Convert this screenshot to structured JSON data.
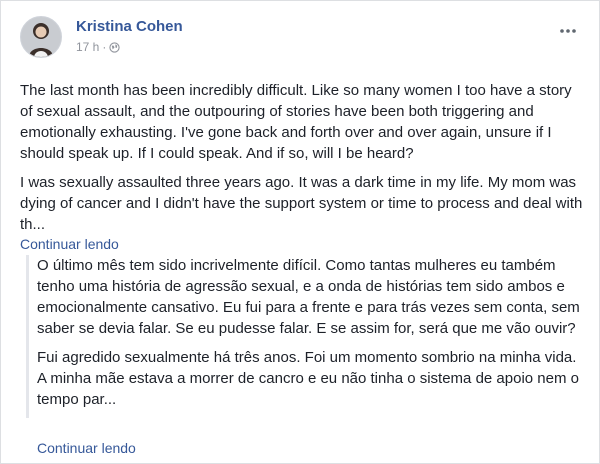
{
  "post": {
    "author": "Kristina Cohen",
    "timestamp": "17 h",
    "separator": "·",
    "privacy_icon": "globe-icon",
    "options_icon": "more-options-icon",
    "paragraphs": [
      "The last month has been incredibly difficult. Like so many women I too have a story of sexual assault, and the outpouring of stories have been both triggering and emotionally exhausting. I've gone back and forth over and over again, unsure if I should speak up. If I could speak. And if so, will I be heard?",
      "I was sexually assaulted three years ago. It was a dark time in my life. My mom was dying of cancer and I didn't have the support system or time to process and deal with th..."
    ],
    "continue_label": "Continuar lendo"
  },
  "translation": {
    "paragraphs": [
      "O último mês tem sido incrivelmente difícil. Como tantas mulheres eu também tenho uma história de agressão sexual, e a onda de histórias tem sido ambos e emocionalmente cansativo. Eu fui para a frente e para trás vezes sem conta, sem saber se devia falar. Se eu pudesse falar. E se assim for, será que me vão ouvir?",
      "Fui agredido sexualmente há três anos. Foi um momento sombrio na minha vida. A minha mãe estava a morrer de cancro e eu não tinha o sistema de apoio nem o tempo par..."
    ],
    "continue_label": "Continuar lendo"
  },
  "colors": {
    "link": "#365899",
    "meta": "#90949c",
    "text": "#1d2129"
  }
}
